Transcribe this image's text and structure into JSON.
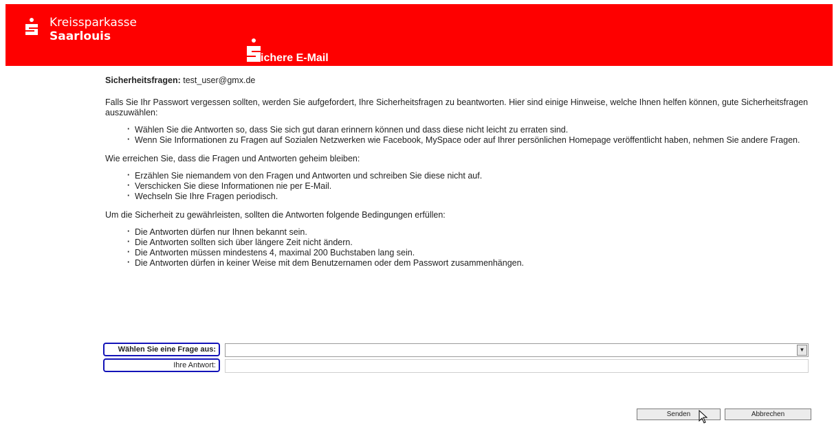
{
  "header": {
    "brand_line1": "Kreissparkasse",
    "brand_line2": "Saarlouis",
    "product": "ichere E-Mail",
    "brand_color": "#fe0000"
  },
  "content": {
    "subject_label": "Sicherheitsfragen:",
    "subject_value": "test_user@gmx.de",
    "intro": "Falls Sie Ihr Passwort vergessen sollten, werden Sie aufgefordert, Ihre Sicherheitsfragen zu beantworten. Hier sind einige Hinweise, welche Ihnen helfen können, gute Sicherheitsfragen auszuwählen:",
    "tips": [
      "Wählen Sie die Antworten so, dass Sie sich gut daran erinnern können und dass diese nicht leicht zu erraten sind.",
      "Wenn Sie Informationen zu Fragen auf Sozialen Netzwerken wie Facebook, MySpace oder auf Ihrer persönlichen Homepage veröffentlicht haben, nehmen Sie andere Fragen."
    ],
    "secret_heading": "Wie erreichen Sie, dass die Fragen und Antworten geheim bleiben:",
    "secret_tips": [
      "Erzählen Sie niemandem von den Fragen und Antworten und schreiben Sie diese nicht auf.",
      "Verschicken Sie diese Informationen nie per E-Mail.",
      "Wechseln Sie Ihre Fragen periodisch."
    ],
    "conditions_heading": "Um die Sicherheit zu gewährleisten, sollten die Antworten folgende Bedingungen erfüllen:",
    "conditions": [
      "Die Antworten dürfen nur Ihnen bekannt sein.",
      "Die Antworten sollten sich über längere Zeit nicht ändern.",
      "Die Antworten müssen mindestens 4, maximal 200 Buchstaben lang sein.",
      "Die Antworten dürfen in keiner Weise mit dem Benutzernamen oder dem Passwort zusammenhängen."
    ]
  },
  "form": {
    "question_label": "Wählen Sie eine Frage aus:",
    "question_value": "",
    "answer_label": "Ihre Antwort:",
    "answer_value": ""
  },
  "buttons": {
    "send": "Senden",
    "cancel": "Abbrechen"
  },
  "icons": {
    "logo": "sparkasse-s-logo-icon",
    "dropdown": "chevron-down-icon",
    "cursor": "mouse-pointer-icon"
  },
  "colors": {
    "header_red": "#fe0000",
    "highlight_border": "#1212b8"
  }
}
